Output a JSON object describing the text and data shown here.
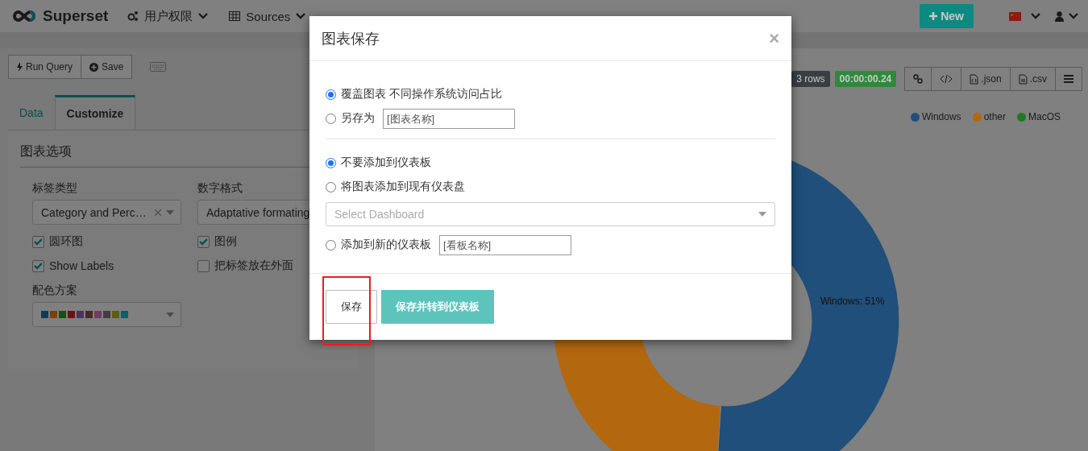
{
  "navbar": {
    "brand": "Superset",
    "menu": [
      {
        "label": "用户权限"
      },
      {
        "label": "Sources"
      }
    ],
    "new_button": "New"
  },
  "toolbar": {
    "buttons": [
      {
        "label": "Run Query"
      },
      {
        "label": "Save"
      }
    ]
  },
  "tabs": [
    {
      "label": "Data",
      "selected": false
    },
    {
      "label": "Customize",
      "selected": true
    }
  ],
  "panel": {
    "title": "图表选项",
    "fields": [
      {
        "label": "标签类型",
        "value": "Category and Perc…"
      },
      {
        "label": "数字格式",
        "value": "Adaptative formating"
      }
    ],
    "checkboxes": [
      {
        "label": "圆环图",
        "checked": true
      },
      {
        "label": "图例",
        "checked": true
      },
      {
        "label": "Show Labels",
        "checked": true
      },
      {
        "label": "把标签放在外面",
        "checked": false
      }
    ],
    "color_scheme": {
      "label": "配色方案",
      "swatches": [
        {
          "color": "#0f3b5a"
        },
        {
          "color": "#7f3f07"
        },
        {
          "color": "#165016"
        },
        {
          "color": "#6b1314"
        },
        {
          "color": "#4a335e"
        },
        {
          "color": "#462b25"
        },
        {
          "color": "#713b61"
        },
        {
          "color": "#3f3f3f"
        },
        {
          "color": "#5e5e11"
        },
        {
          "color": "#0b5f67"
        }
      ]
    }
  },
  "results": {
    "rows": "3 rows",
    "duration": "00:00:00.24",
    "actions": [
      {
        "kind": "link"
      },
      {
        "kind": "code"
      },
      {
        "kind": "json",
        "label": ".json"
      },
      {
        "kind": "csv",
        "label": ".csv"
      },
      {
        "kind": "menu"
      }
    ]
  },
  "legend": [
    {
      "label": "Windows",
      "color": "#1f4f7a"
    },
    {
      "label": "other",
      "color": "#b3670f"
    },
    {
      "label": "MacOS",
      "color": "#1f7a1f"
    }
  ],
  "chart_label": "Windows: 51%",
  "modal": {
    "title": "图表保存",
    "close": "×",
    "save_options": [
      {
        "label": "覆盖图表 不同操作系统访问占比",
        "selected": true
      },
      {
        "label": "另存为",
        "selected": false,
        "placeholder": "[图表名称]"
      }
    ],
    "dashboard_options": [
      {
        "label": "不要添加到仪表板",
        "selected": true
      },
      {
        "label": "将图表添加到现有仪表盘",
        "selected": false,
        "select_placeholder": "Select Dashboard"
      },
      {
        "label": "添加到新的仪表板",
        "selected": false,
        "placeholder": "[看板名称]"
      }
    ],
    "buttons": [
      {
        "label": "保存",
        "kind": "default"
      },
      {
        "label": "保存并转到仪表板",
        "kind": "primary"
      }
    ]
  }
}
